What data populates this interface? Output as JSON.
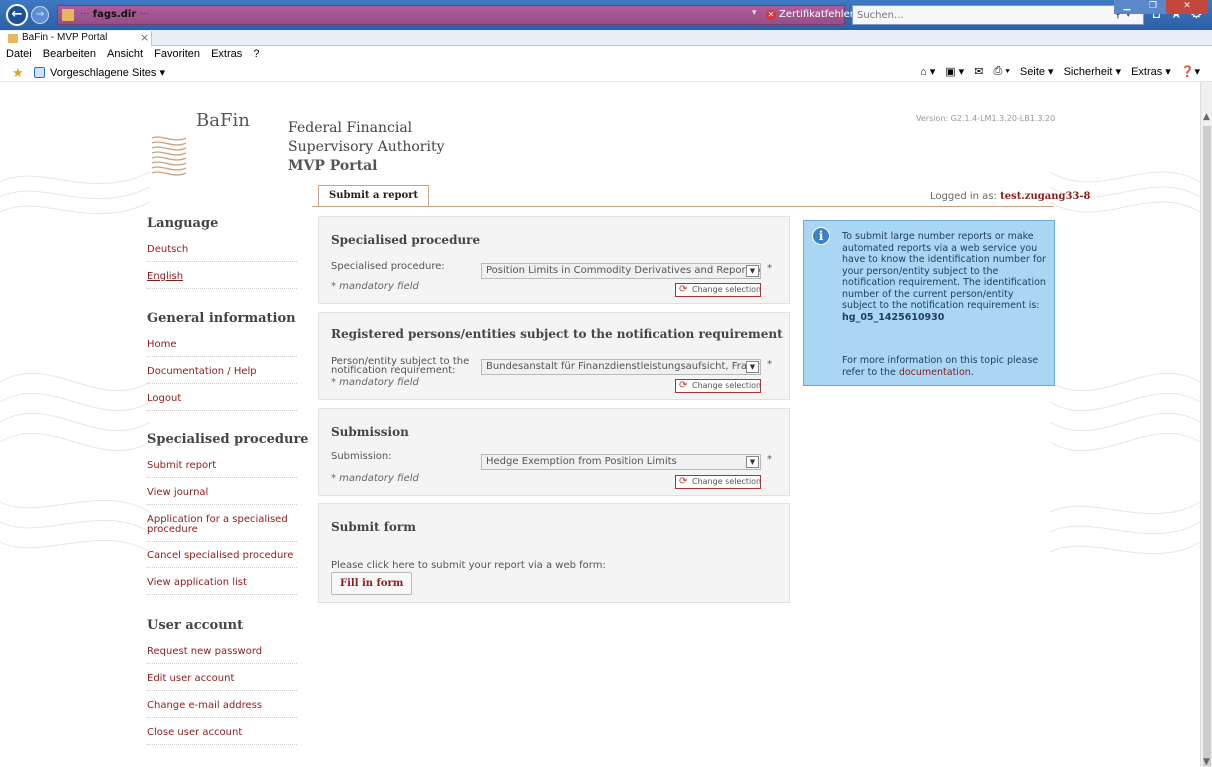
{
  "browser": {
    "url_domain": "fags.dir",
    "cert_error": "Zertifikatfehler",
    "search_placeholder": "Suchen...",
    "tab_title": "BaFin - MVP Portal",
    "menu": [
      "Datei",
      "Bearbeiten",
      "Ansicht",
      "Favoriten",
      "Extras",
      "?"
    ],
    "favorites_item": "Vorgeschlagene Sites ▾",
    "command_bar": [
      "Seite ▾",
      "Sicherheit ▾",
      "Extras ▾"
    ]
  },
  "header": {
    "logo_text": "BaFin",
    "org_line1": "Federal Financial",
    "org_line2": "Supervisory Authority",
    "portal_name": "MVP Portal",
    "version": "Version: G2.1.4-LM1.3.20-LB1.3.20",
    "tab_label": "Submit a report",
    "logged_in_label": "Logged in as:",
    "logged_in_user": "test.zugang33-8"
  },
  "sidebar": {
    "language": {
      "heading": "Language",
      "items": [
        "Deutsch",
        "English"
      ]
    },
    "general": {
      "heading": "General information",
      "items": [
        "Home",
        "Documentation / Help",
        "Logout"
      ]
    },
    "procedure": {
      "heading": "Specialised procedure",
      "items": [
        "Submit report",
        "View journal",
        "Application for a specialised procedure",
        "Cancel specialised procedure",
        "View application list"
      ]
    },
    "account": {
      "heading": "User account",
      "items": [
        "Request new password",
        "Edit user account",
        "Change e-mail address",
        "Close user account"
      ]
    }
  },
  "panels": {
    "procedure": {
      "title": "Specialised procedure",
      "label": "Specialised procedure:",
      "value": "Position Limits in Commodity Derivatives and Reporting",
      "mandatory": "* mandatory field",
      "change": "Change selection"
    },
    "registered": {
      "title": "Registered persons/entities subject to the notification requirement",
      "label_line1": "Person/entity subject to the",
      "label_line2": "notification requirement:",
      "value": "Bundesanstalt für Finanzdienstleistungsaufsicht, Frankfurt",
      "mandatory": "* mandatory field",
      "change": "Change selection"
    },
    "submission": {
      "title": "Submission",
      "label": "Submission:",
      "value": "Hedge Exemption from Position Limits",
      "mandatory": "* mandatory field",
      "change": "Change selection"
    },
    "submit_form": {
      "title": "Submit form",
      "description": "Please click here to submit your report via a web form:",
      "button": "Fill in form"
    }
  },
  "info_box": {
    "text": "To submit large number reports or make automated reports via a web service you have to know the identification number for your person/entity subject to the notification requirement. The identification number of the current person/entity subject to the notification requirement is:",
    "identification": "hg_05_1425610930",
    "more_prefix": "For more information on this topic please refer to the ",
    "more_link": "documentation",
    "more_suffix": "."
  },
  "colors": {
    "link": "#8c1c1c",
    "info_bg": "#a9d6f2",
    "titlebar": "#2c5fa6"
  }
}
